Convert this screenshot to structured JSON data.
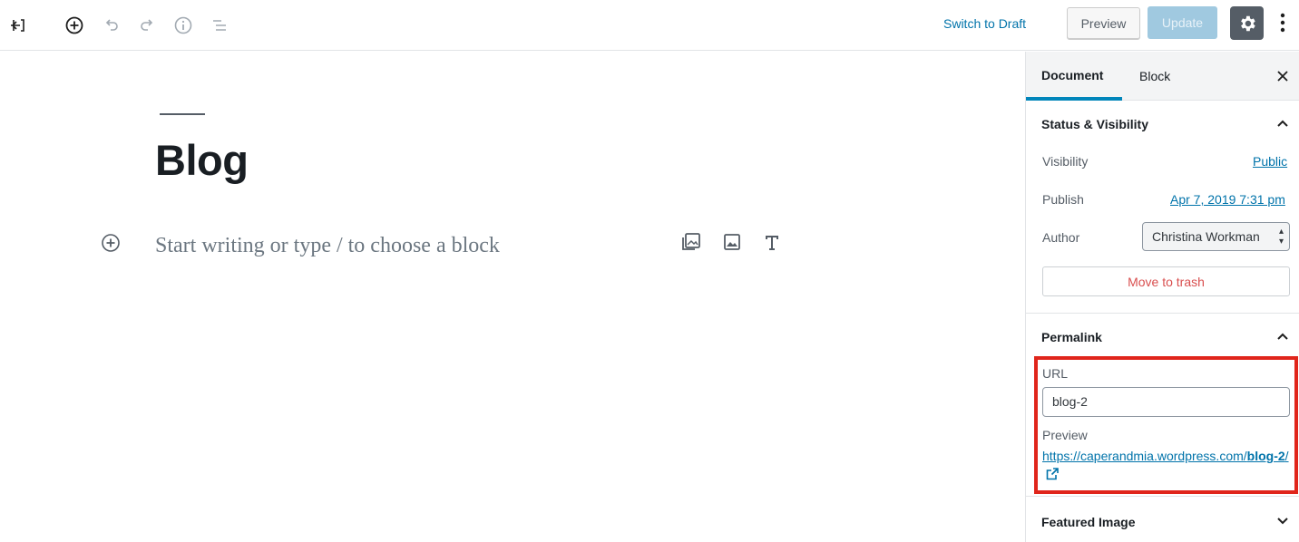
{
  "toolbar": {
    "back_icon": "exit-editor-icon",
    "add_block_icon": "add-block-icon",
    "undo_icon": "undo-icon",
    "redo_icon": "redo-icon",
    "info_icon": "info-icon",
    "outline_icon": "block-navigation-icon",
    "switch_to_draft": "Switch to Draft",
    "preview": "Preview",
    "update": "Update",
    "settings_icon": "gear-icon",
    "more_icon": "more-vertical-icon"
  },
  "editor": {
    "post_title": "Blog",
    "placeholder": "Start writing or type / to choose a block",
    "quick_inserts": [
      "gallery-icon",
      "image-icon",
      "heading-icon"
    ]
  },
  "sidebar": {
    "tabs": [
      {
        "label": "Document",
        "active": true
      },
      {
        "label": "Block",
        "active": false
      }
    ],
    "status_visibility": {
      "title": "Status & Visibility",
      "visibility_label": "Visibility",
      "visibility_value": "Public",
      "publish_label": "Publish",
      "publish_value": "Apr 7, 2019 7:31 pm",
      "author_label": "Author",
      "author_value": "Christina Workman",
      "move_to_trash": "Move to trash"
    },
    "permalink": {
      "title": "Permalink",
      "url_label": "URL",
      "url_value": "blog-2",
      "preview_label": "Preview",
      "preview_base": "https://caperandmia.wordpress.com/",
      "preview_slug": "blog-2",
      "preview_tail": "/"
    },
    "featured_image": {
      "title": "Featured Image"
    }
  },
  "colors": {
    "accent": "#0073aa",
    "highlight": "#e0251b",
    "danger": "#d94f4f"
  }
}
